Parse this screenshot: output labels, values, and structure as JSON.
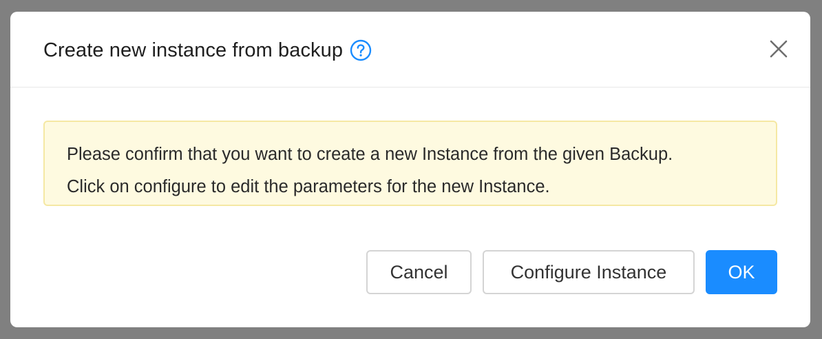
{
  "dialog": {
    "title": "Create new instance from backup",
    "help_icon": "question-circle-icon",
    "close_icon": "close-icon"
  },
  "alert": {
    "line1": "Please confirm that you want to create a new Instance from the given Backup.",
    "line2": "Click on configure to edit the parameters for the new Instance."
  },
  "footer": {
    "cancel_label": "Cancel",
    "configure_label": "Configure Instance",
    "ok_label": "OK"
  },
  "colors": {
    "primary": "#1a8cff",
    "alert_background": "#fefae0",
    "alert_border": "#f5e8a3",
    "overlay": "#808080"
  }
}
